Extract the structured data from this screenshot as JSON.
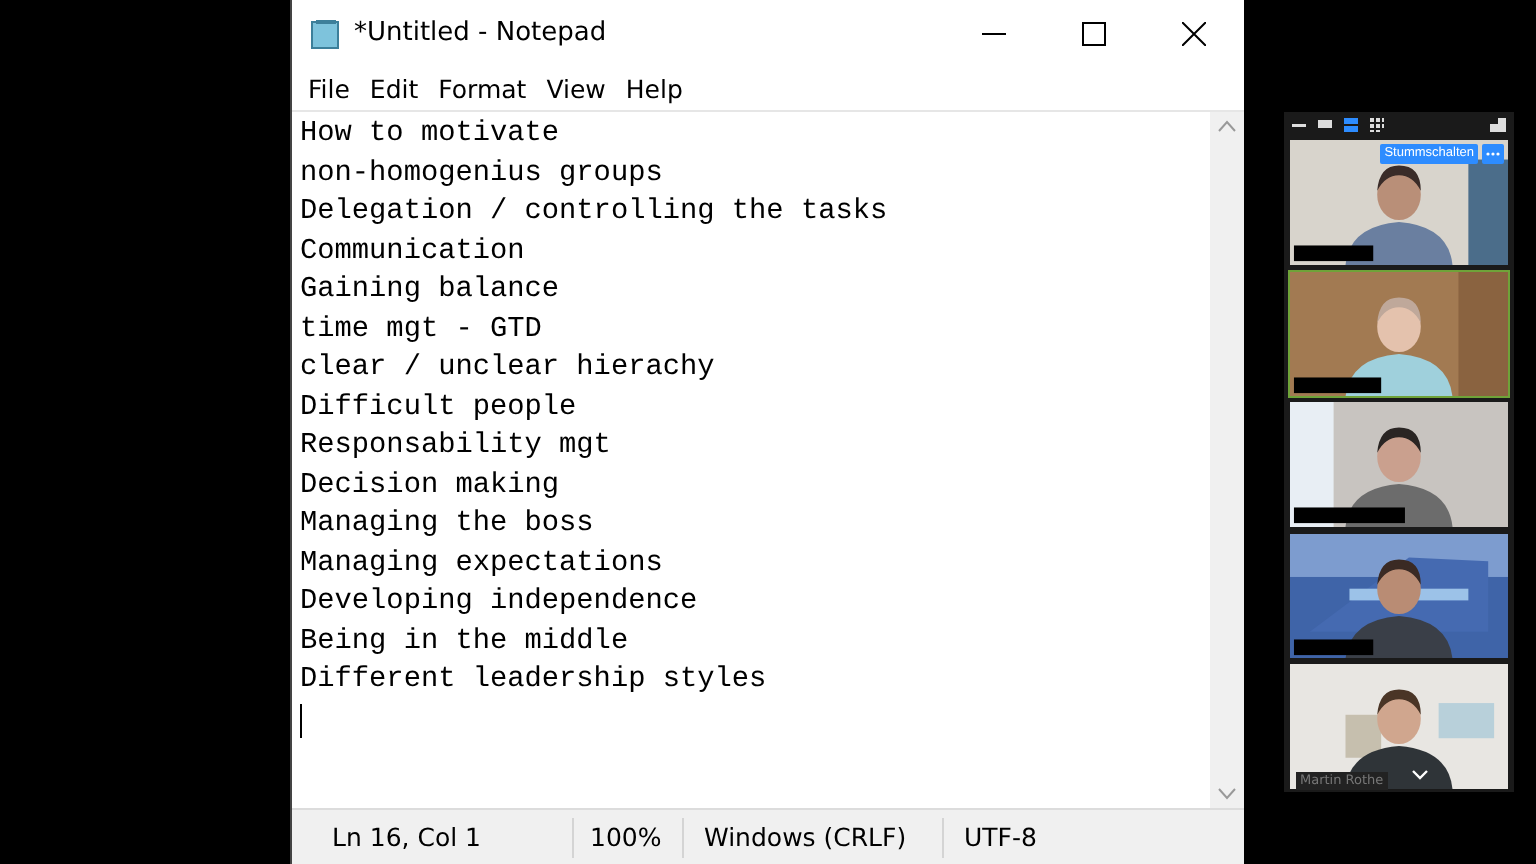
{
  "window": {
    "title": "*Untitled - Notepad"
  },
  "menu": [
    "File",
    "Edit",
    "Format",
    "View",
    "Help"
  ],
  "editor": {
    "lines": [
      "How to motivate",
      "non-homogenius groups",
      "Delegation / controlling the tasks",
      "Communication",
      "Gaining balance",
      "time mgt - GTD",
      "clear / unclear hierachy",
      "Difficult people",
      "Responsability mgt",
      "Decision making",
      "Managing the boss",
      "Managing expectations",
      "Developing independence",
      "Being in the middle",
      "Different leadership styles"
    ]
  },
  "status_bar": [
    "Ln 16, Col 1",
    "100%",
    "Windows (CRLF)",
    "UTF-8"
  ],
  "video_panel": {
    "mute_button": "Stummschalten",
    "tiles": [
      {
        "kind": "picture",
        "active": false
      },
      {
        "kind": "picture",
        "active": true
      },
      {
        "kind": "picture",
        "active": false
      },
      {
        "kind": "picture",
        "active": false
      },
      {
        "kind": "picture",
        "active": false,
        "name": "Martin Rothe"
      }
    ]
  }
}
